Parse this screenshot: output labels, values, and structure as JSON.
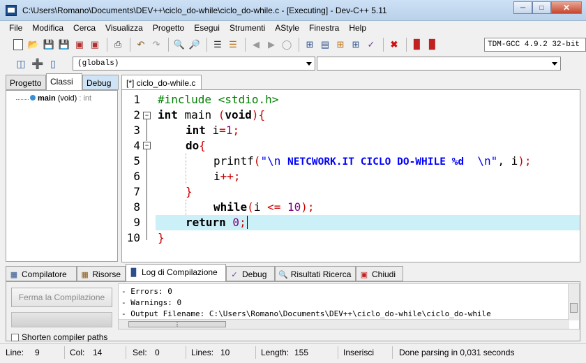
{
  "window": {
    "title": "C:\\Users\\Romano\\Documents\\DEV++\\ciclo_do-while\\ciclo_do-while.c - [Executing] - Dev-C++ 5.11"
  },
  "menu": [
    "File",
    "Modifica",
    "Cerca",
    "Visualizza",
    "Progetto",
    "Esegui",
    "Strumenti",
    "AStyle",
    "Finestra",
    "Help"
  ],
  "toolbar": {
    "compiler": "TDM-GCC 4.9.2 32-bit"
  },
  "toolbar2": {
    "scope_combo": "(globals)",
    "member_combo": ""
  },
  "left_panel": {
    "tabs": [
      "Progetto",
      "Classi",
      "Debug"
    ],
    "tree": {
      "name": "main",
      "signature": "(void)",
      "type": ": int"
    }
  },
  "editor": {
    "tab": "[*] ciclo_do-while.c",
    "line_numbers": [
      "1",
      "2",
      "3",
      "4",
      "5",
      "6",
      "7",
      "8",
      "9",
      "10"
    ],
    "code": {
      "l1": "#include <stdio.h>",
      "l2_kw": "int",
      "l2_name": " main ",
      "l2_open": "(",
      "l2_void": "void",
      "l2_close": "){",
      "l3_kw": "int",
      "l3_var": " i",
      "l3_eq": "=",
      "l3_num": "1",
      "l3_end": ";",
      "l4_kw": "do",
      "l4_brace": "{",
      "l5_fn": "printf",
      "l5_open": "(",
      "l5_q1": "\"\\n ",
      "l5_str": "NETCWORK.IT CICLO DO-WHILE %d",
      "l5_q2": "  \\n\"",
      "l5_rest": ", i",
      "l5_end": ");",
      "l6_var": "i",
      "l6_op": "++;",
      "l7": "}",
      "l8_kw": "while",
      "l8_open": "(",
      "l8_var": "i ",
      "l8_op": "<=",
      "l8_num": " 10",
      "l8_end": ");",
      "l9_kw": "return",
      "l9_num": " 0",
      "l9_end": ";",
      "l10": "}"
    }
  },
  "bottom_tabs": [
    "Compilatore",
    "Risorse",
    "Log di Compilazione",
    "Debug",
    "Risultati Ricerca",
    "Chiudi"
  ],
  "bottom_panel": {
    "stop_button": "Ferma la Compilazione",
    "shorten_label": "Shorten compiler paths",
    "log": [
      "- Errors: 0",
      "- Warnings: 0",
      "- Output Filename: C:\\Users\\Romano\\Documents\\DEV++\\ciclo_do-while\\ciclo_do-while"
    ]
  },
  "status": {
    "line_label": "Line:",
    "line": "9",
    "col_label": "Col:",
    "col": "14",
    "sel_label": "Sel:",
    "sel": "0",
    "lines_label": "Lines:",
    "lines": "10",
    "length_label": "Length:",
    "length": "155",
    "mode": "Inserisci",
    "message": "Done parsing in 0,031 seconds"
  }
}
